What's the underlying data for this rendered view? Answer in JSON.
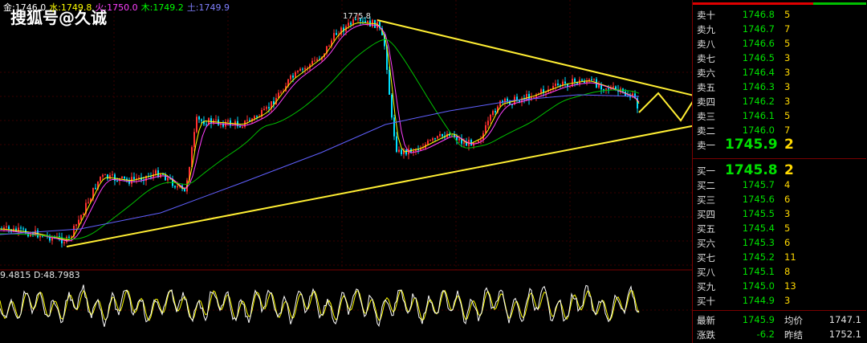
{
  "watermark": "搜狐号@久诚",
  "legend": [
    {
      "label": "金:1746.0",
      "color": "#ffffff"
    },
    {
      "label": "水:1749.8",
      "color": "#ffff00"
    },
    {
      "label": "火:1750.0",
      "color": "#ff40ff"
    },
    {
      "label": "木:1749.2",
      "color": "#00ff00"
    },
    {
      "label": "土:1749.9",
      "color": "#8080ff"
    }
  ],
  "peak_label": "1775.8",
  "oscillator_label": "9.4815 D:48.7983",
  "colors": {
    "up": "#ff3030",
    "down": "#00e0ff",
    "trendline": "#ffee33",
    "bid_ask_price": "#00e000",
    "volume": "#ffd800"
  },
  "order_book": {
    "asks": [
      {
        "label": "卖十",
        "price": "1746.8",
        "volume": "5"
      },
      {
        "label": "卖九",
        "price": "1746.7",
        "volume": "7"
      },
      {
        "label": "卖八",
        "price": "1746.6",
        "volume": "5"
      },
      {
        "label": "卖七",
        "price": "1746.5",
        "volume": "3"
      },
      {
        "label": "卖六",
        "price": "1746.4",
        "volume": "3"
      },
      {
        "label": "卖五",
        "price": "1746.3",
        "volume": "3"
      },
      {
        "label": "卖四",
        "price": "1746.2",
        "volume": "3"
      },
      {
        "label": "卖三",
        "price": "1746.1",
        "volume": "5"
      },
      {
        "label": "卖二",
        "price": "1746.0",
        "volume": "7"
      },
      {
        "label": "卖一",
        "price": "1745.9",
        "volume": "2"
      }
    ],
    "bids": [
      {
        "label": "买一",
        "price": "1745.8",
        "volume": "2"
      },
      {
        "label": "买二",
        "price": "1745.7",
        "volume": "4"
      },
      {
        "label": "买三",
        "price": "1745.6",
        "volume": "6"
      },
      {
        "label": "买四",
        "price": "1745.5",
        "volume": "3"
      },
      {
        "label": "买五",
        "price": "1745.4",
        "volume": "5"
      },
      {
        "label": "买六",
        "price": "1745.3",
        "volume": "6"
      },
      {
        "label": "买七",
        "price": "1745.2",
        "volume": "11"
      },
      {
        "label": "买八",
        "price": "1745.1",
        "volume": "8"
      },
      {
        "label": "买九",
        "price": "1745.0",
        "volume": "13"
      },
      {
        "label": "买十",
        "price": "1744.9",
        "volume": "3"
      }
    ]
  },
  "stats": {
    "latest_label": "最新",
    "latest_value": "1745.9",
    "avg_label": "均价",
    "avg_value": "1747.1",
    "change_label": "涨跌",
    "change_value": "-6.2",
    "prev_close_label": "昨结",
    "prev_close_value": "1752.1"
  }
}
